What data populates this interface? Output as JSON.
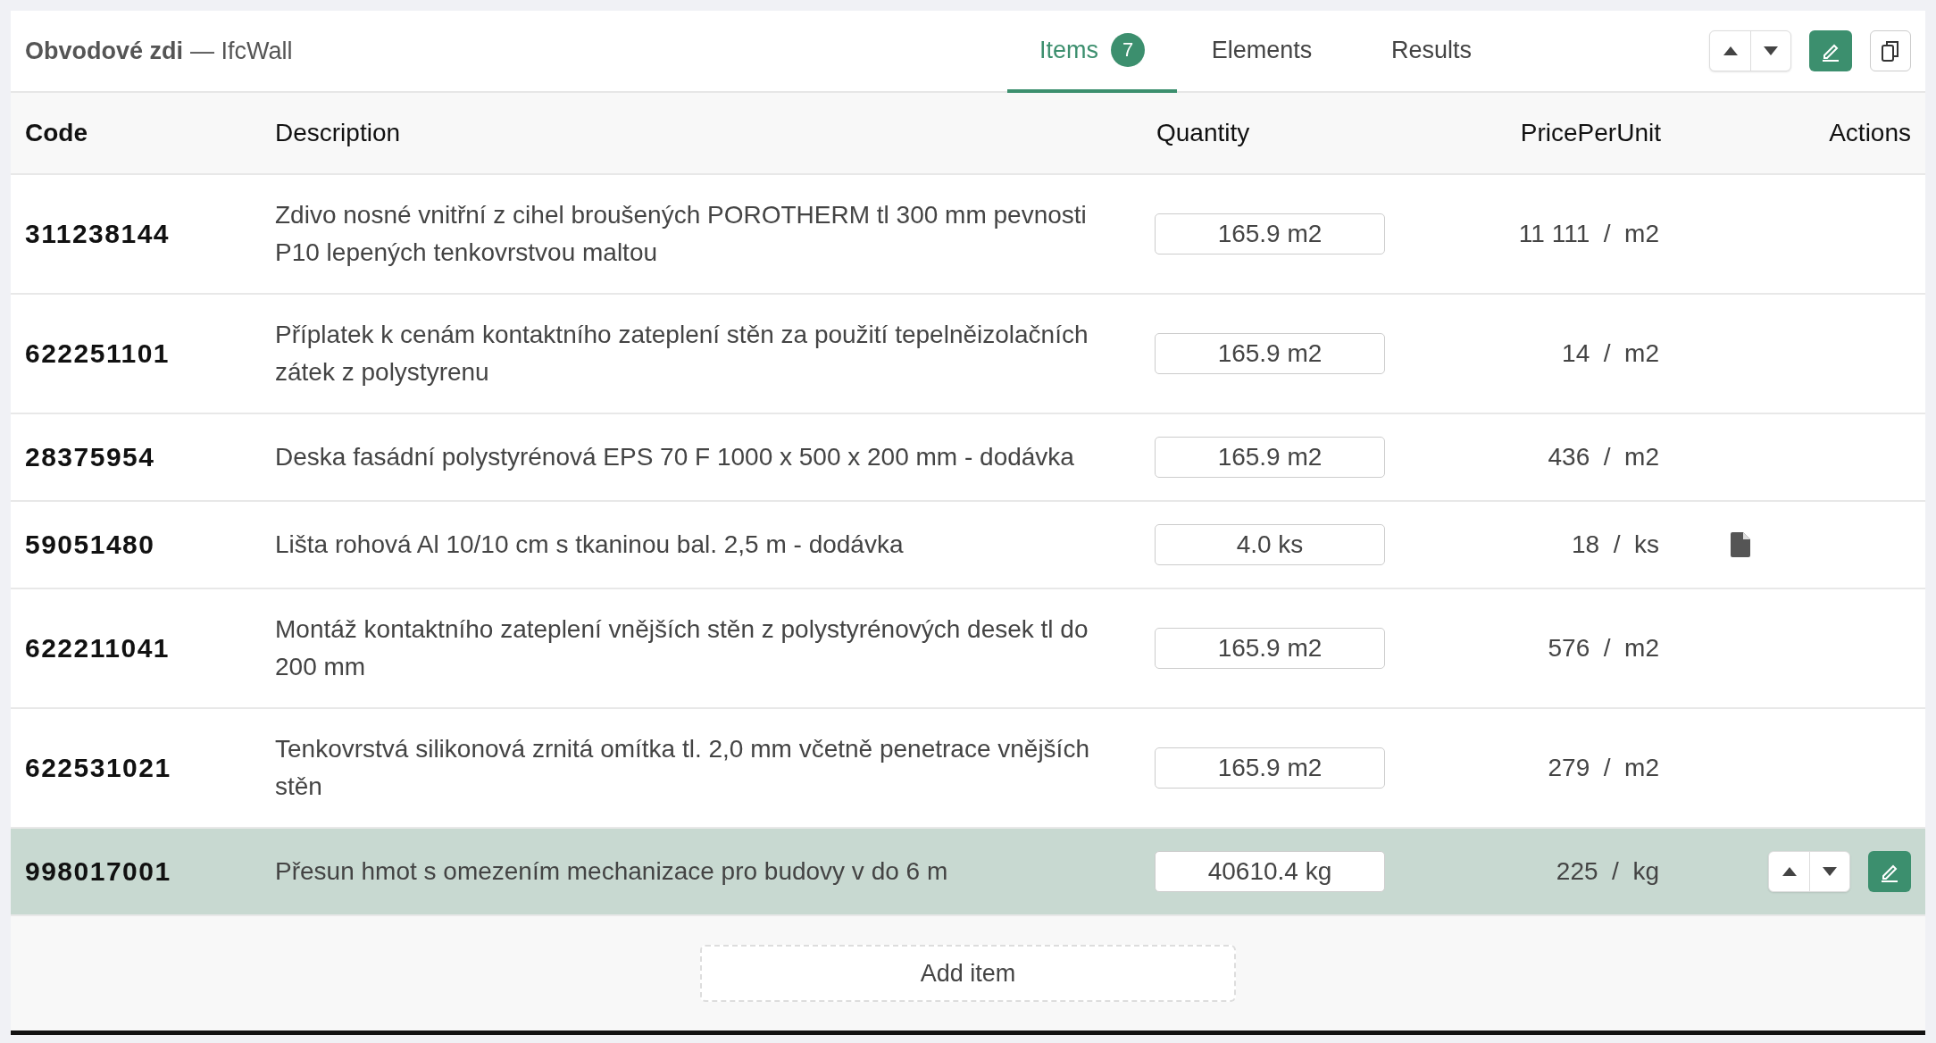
{
  "header": {
    "title": "Obvodové zdi",
    "subtitle": "— IfcWall"
  },
  "tabs": [
    {
      "label": "Items",
      "badge": "7",
      "selected": true
    },
    {
      "label": "Elements",
      "selected": false
    },
    {
      "label": "Results",
      "selected": false
    }
  ],
  "table": {
    "columns": [
      "Code",
      "Description",
      "Quantity",
      "PricePerUnit",
      "Actions"
    ],
    "rows": [
      {
        "code": "311238144",
        "description": "Zdivo nosné vnitřní z cihel broušených POROTHERM tl 300 mm pevnosti P10 lepených tenkovrstvou maltou",
        "quantity": "165.9 m2",
        "price": "11 111  /  m2",
        "has_document": false,
        "selected": false
      },
      {
        "code": "622251101",
        "description": "Příplatek k cenám kontaktního zateplení stěn za použití tepelněizolačních zátek z polystyrenu",
        "quantity": "165.9 m2",
        "price": "14  /  m2",
        "has_document": false,
        "selected": false
      },
      {
        "code": "28375954",
        "description": "Deska fasádní polystyrénová EPS 70 F 1000 x 500 x 200 mm - dodávka",
        "quantity": "165.9 m2",
        "price": "436  /  m2",
        "has_document": false,
        "selected": false
      },
      {
        "code": "59051480",
        "description": "Lišta rohová Al 10/10 cm s tkaninou bal. 2,5 m - dodávka",
        "quantity": "4.0 ks",
        "price": "18  /  ks",
        "has_document": true,
        "selected": false
      },
      {
        "code": "622211041",
        "description": "Montáž kontaktního zateplení vnějších stěn z polystyrénových desek tl do 200 mm",
        "quantity": "165.9 m2",
        "price": "576  /  m2",
        "has_document": false,
        "selected": false
      },
      {
        "code": "622531021",
        "description": "Tenkovrstvá silikonová zrnitá omítka tl. 2,0 mm včetně penetrace vnějších stěn",
        "quantity": "165.9 m2",
        "price": "279  /  m2",
        "has_document": false,
        "selected": false
      },
      {
        "code": "998017001",
        "description": "Přesun hmot s omezením mechanizace pro budovy v do 6 m",
        "quantity": "40610.4 kg",
        "price": "225  /  kg",
        "has_document": false,
        "selected": true
      }
    ]
  },
  "add_button": "Add item"
}
